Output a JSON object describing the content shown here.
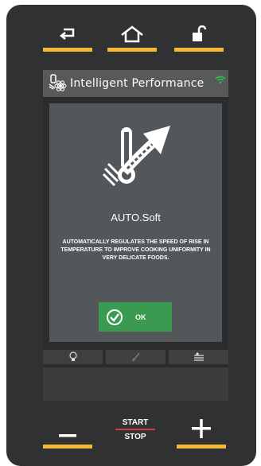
{
  "header": {
    "title": "Intelligent Performance"
  },
  "panel": {
    "program_name": "AUTO.Soft",
    "description": "AUTOMATICALLY REGULATES THE SPEED OF RISE IN TEMPERATURE TO IMPROVE COOKING UNIFORMITY IN VERY DELICATE FOODS.",
    "ok_label": "OK"
  },
  "bottom": {
    "start_label": "START",
    "stop_label": "STOP"
  },
  "icons": {
    "back": "back-arrow-icon",
    "home": "home-icon",
    "lock": "unlock-icon",
    "wifi": "wifi-icon",
    "minus": "minus-icon",
    "plus": "plus-icon"
  },
  "colors": {
    "accent_yellow": "#f4b733",
    "ok_green": "#3a9a52",
    "wifi_green": "#2fbf4a",
    "stop_line": "#d43b45",
    "device_bg": "#2f3133"
  }
}
